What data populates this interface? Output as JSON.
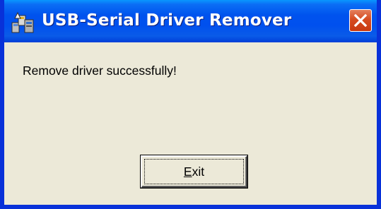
{
  "window": {
    "title": "USB-Serial Driver Remover",
    "icon": "driver-installer-icon",
    "close_icon": "close-icon"
  },
  "dialog": {
    "message": "Remove driver successfully!",
    "exit_button": {
      "mnemonic": "E",
      "rest": "xit"
    }
  },
  "colors": {
    "titlebar": "#0053ee",
    "client_background": "#ece9d8",
    "close_button": "#d64b20"
  }
}
